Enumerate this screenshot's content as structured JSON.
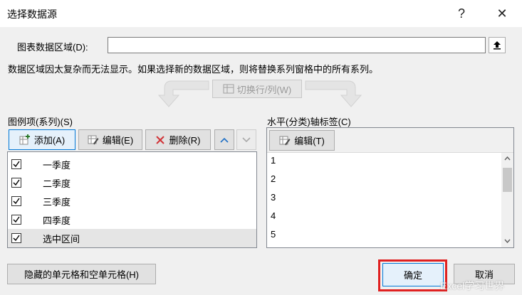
{
  "window": {
    "title": "选择数据源",
    "help_label": "?",
    "close_label": "✕"
  },
  "data_range": {
    "label": "图表数据区域(D):",
    "value": "",
    "collapse_icon": "upload-arrow-icon"
  },
  "message": "数据区域因太复杂而无法显示。如果选择新的数据区域，则将替换系列窗格中的所有系列。",
  "switch_button": {
    "label": "切换行/列(W)"
  },
  "legend_panel": {
    "title": "图例项(系列)(S)",
    "add_label": "添加(A)",
    "edit_label": "编辑(E)",
    "delete_label": "删除(R)",
    "series": [
      {
        "name": "一季度",
        "checked": true
      },
      {
        "name": "二季度",
        "checked": true
      },
      {
        "name": "三季度",
        "checked": true
      },
      {
        "name": "四季度",
        "checked": true
      },
      {
        "name": "选中区间",
        "checked": true
      }
    ]
  },
  "axis_panel": {
    "title": "水平(分类)轴标签(C)",
    "edit_label": "编辑(T)",
    "items": [
      "1",
      "2",
      "3",
      "4",
      "5"
    ]
  },
  "footer": {
    "hidden_cells_label": "隐藏的单元格和空单元格(H)",
    "ok_label": "确定",
    "cancel_label": "取消"
  },
  "watermark": "Excel学习世界",
  "colors": {
    "highlight": "#e02020",
    "focus_blue": "#0078d7",
    "delete_red": "#d13438"
  }
}
